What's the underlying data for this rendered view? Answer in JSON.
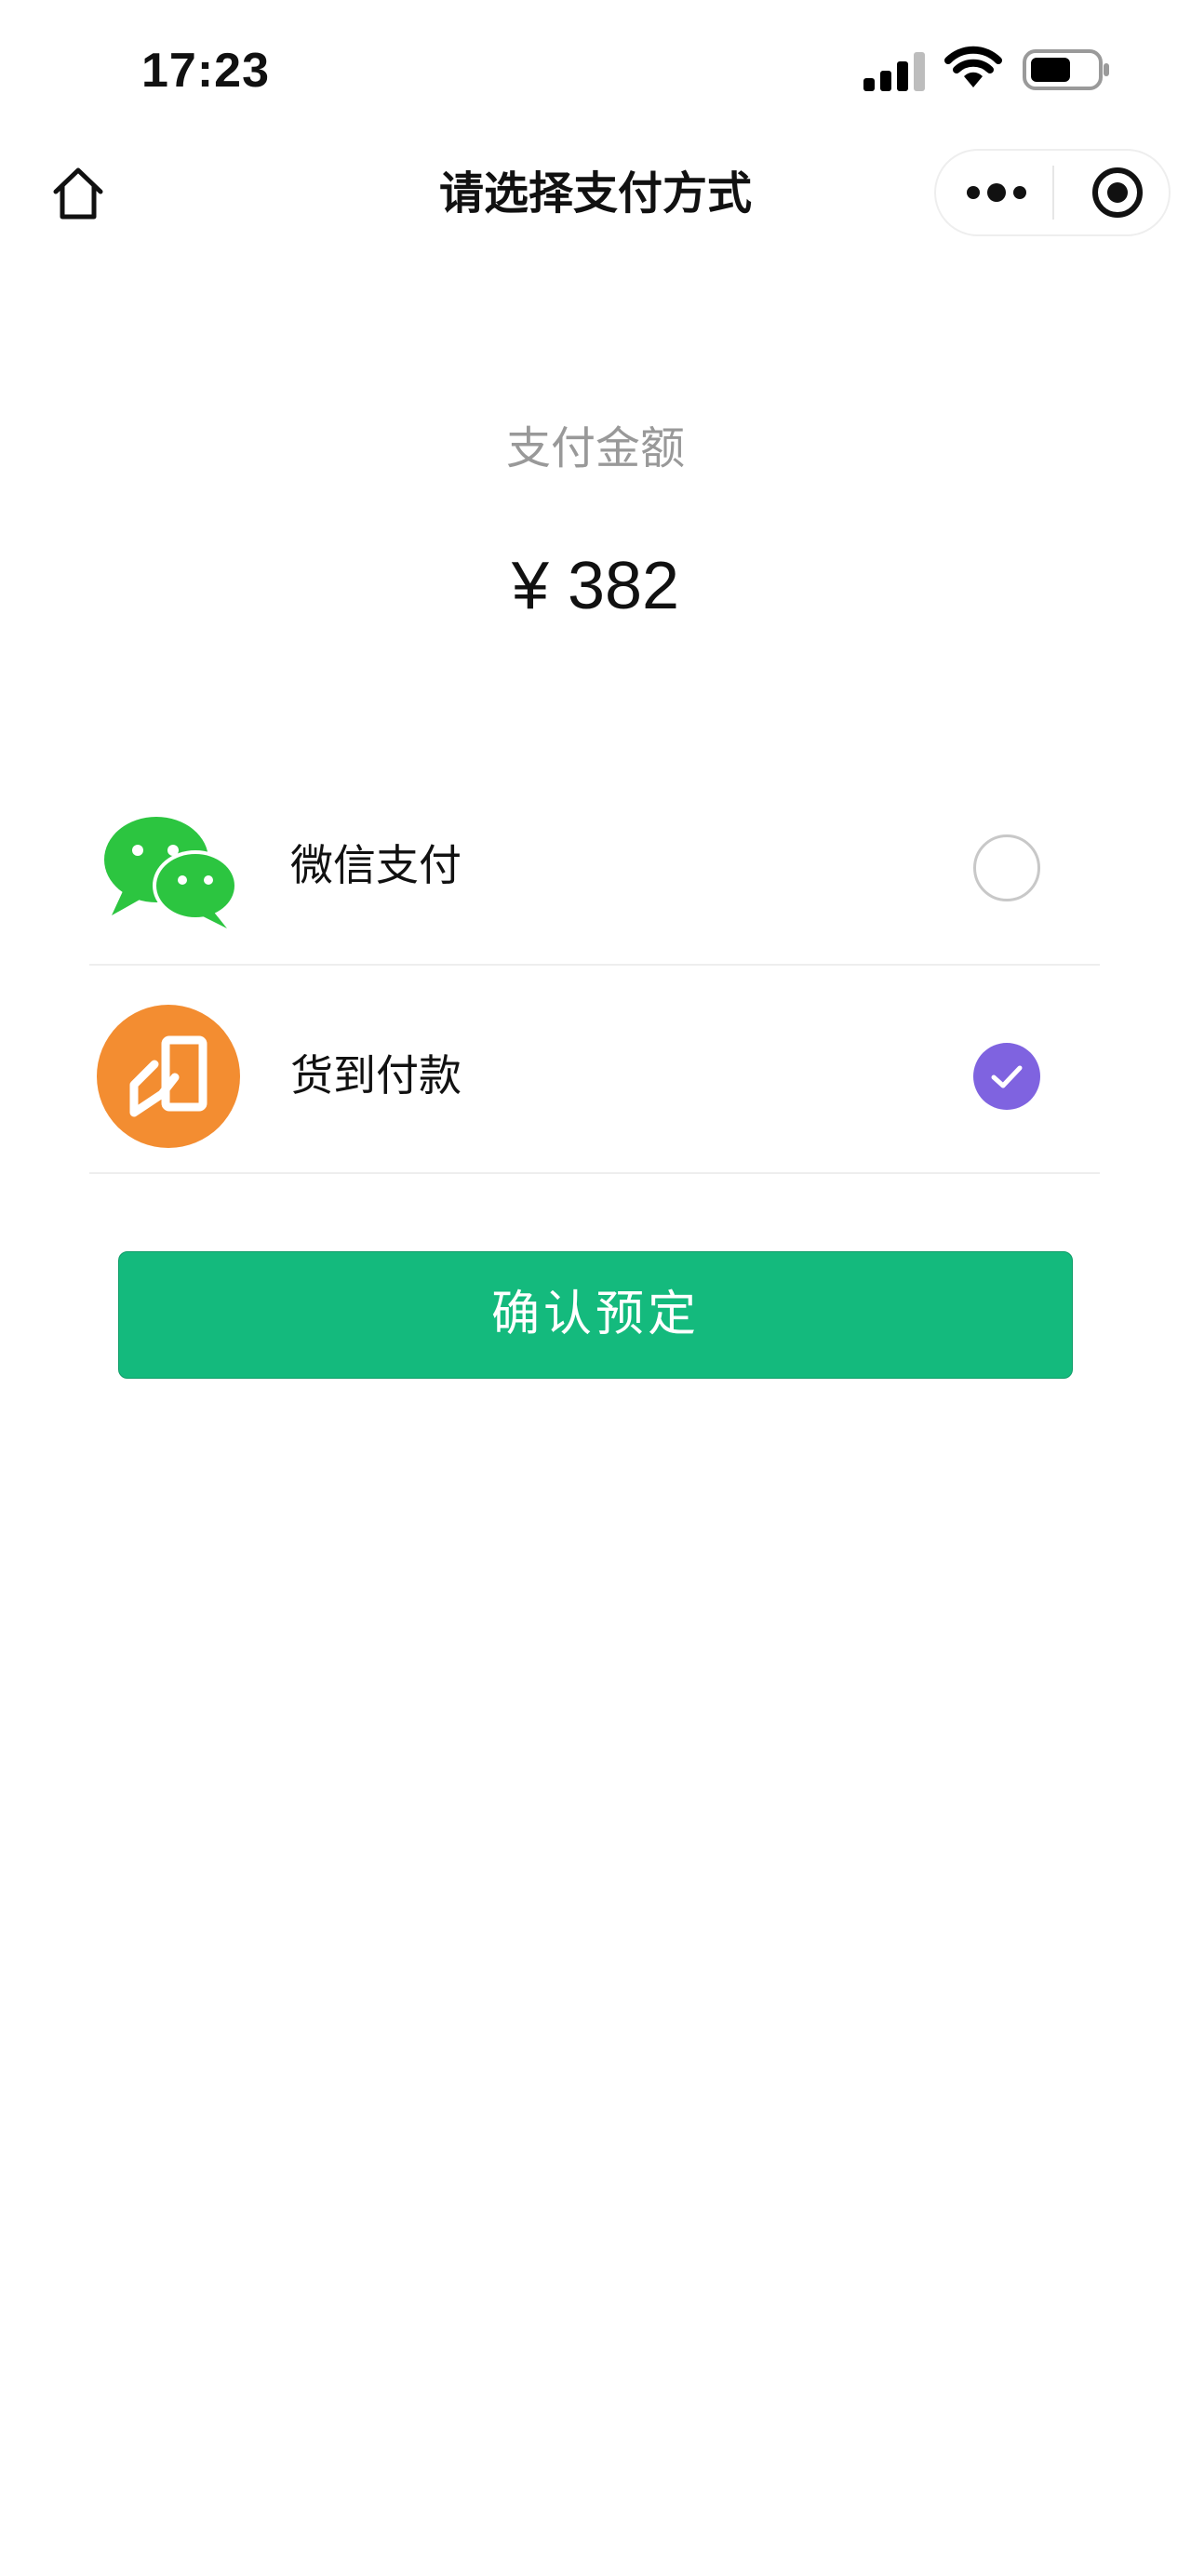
{
  "status_bar": {
    "time": "17:23",
    "icons": [
      "signal-icon",
      "wifi-icon",
      "battery-icon"
    ]
  },
  "nav": {
    "title": "请选择支付方式",
    "home_icon": "home-icon",
    "more_icon": "more-dots-icon",
    "close_icon": "target-close-icon"
  },
  "amount": {
    "label": "支付金额",
    "value": "¥ 382"
  },
  "payment_methods": [
    {
      "label": "微信支付",
      "icon": "wechat-pay-icon",
      "selected": false
    },
    {
      "label": "货到付款",
      "icon": "cash-on-delivery-icon",
      "selected": true
    }
  ],
  "confirm_button": {
    "label": "确认预定"
  },
  "colors": {
    "primary_green": "#14ba7d",
    "selected_purple": "#7f63e0",
    "wechat_green": "#2cc540",
    "cod_orange": "#f38d31",
    "muted_text": "#999999"
  }
}
